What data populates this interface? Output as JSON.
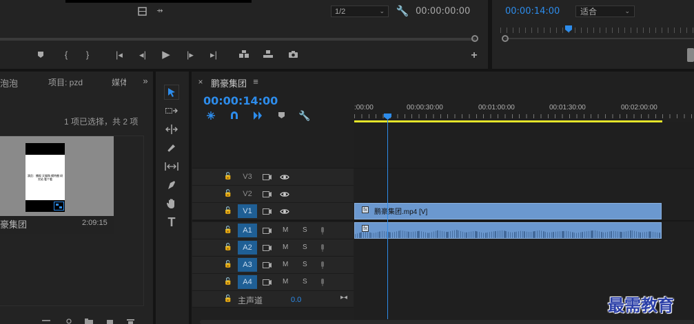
{
  "program_monitor": {
    "zoom_select": "1/2",
    "timecode": "00:00:00:00"
  },
  "source_monitor": {
    "timecode": "00:00:14:00",
    "fit_select": "适合"
  },
  "project_panel": {
    "tabs": [
      "泡泡",
      "项目: pzd",
      "媒体"
    ],
    "selection_info": "1 项已选择，共 2 项",
    "clip_name": "豪集团",
    "clip_duration": "2:09:15",
    "thumb_text": "演员：播报 天猫购 模特圈 研究站 看个看"
  },
  "timeline": {
    "sequence_name": "鹏豪集团",
    "timecode": "00:00:14:00",
    "ruler_labels": [
      ":00:00",
      "00:00:30:00",
      "00:01:00:00",
      "00:01:30:00",
      "00:02:00:00"
    ],
    "video_tracks": [
      "V3",
      "V2",
      "V1"
    ],
    "audio_tracks": [
      "A1",
      "A2",
      "A3",
      "A4"
    ],
    "track_mute": "M",
    "track_solo": "S",
    "master_label": "主声道",
    "master_value": "0.0",
    "video_clip_label": "鹏豪集团.mp4 [V]"
  },
  "watermark": "最需教育",
  "colors": {
    "accent_blue": "#2d8ceb",
    "clip_blue": "#6b98cf",
    "track_selected": "#1f5f95",
    "work_area_yellow": "#e5e52a"
  }
}
